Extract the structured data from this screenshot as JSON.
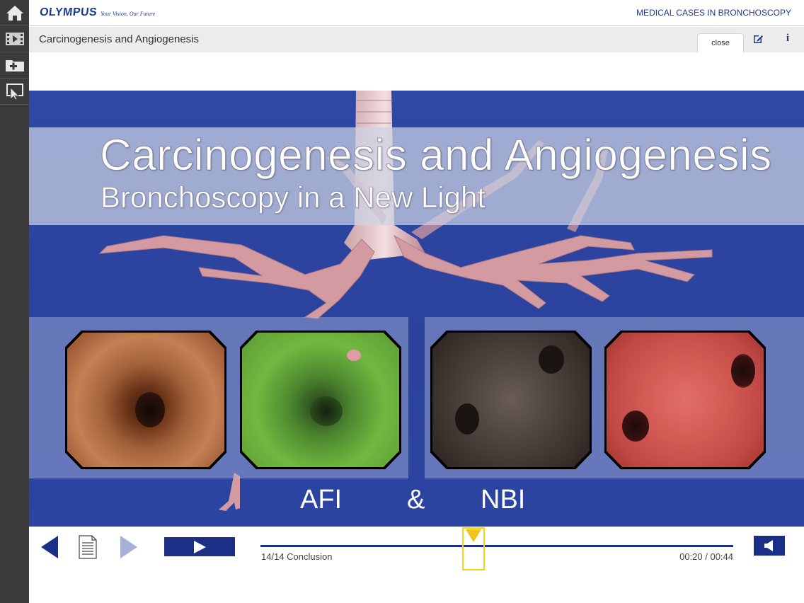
{
  "sidebar": {
    "items": [
      {
        "icon": "home-icon"
      },
      {
        "icon": "film-icon"
      },
      {
        "icon": "add-folder-icon"
      },
      {
        "icon": "presentation-icon"
      }
    ]
  },
  "header": {
    "logo_text": "OLYMPUS",
    "logo_tagline": "Your Vision, Our Future",
    "app_title": "MEDICAL CASES IN BRONCHOSCOPY"
  },
  "subheader": {
    "page_title": "Carcinogenesis and Angiogenesis",
    "close_label": "close",
    "edit_icon": "edit-icon",
    "info_icon": "info-icon",
    "info_glyph": "i"
  },
  "video": {
    "title": "Carcinogenesis and Angiogenesis",
    "subtitle": "Bronchoscopy in a New Light",
    "label_left": "AFI",
    "label_amp": "&",
    "label_right": "NBI",
    "background_color": "#2f48a6"
  },
  "player": {
    "chapter": "14/14 Conclusion",
    "time": "00:20 / 00:44",
    "progress_fraction": 0.45,
    "accent_color": "#1c2f86",
    "scrubber_color": "#f0c419",
    "icons": [
      "prev-icon",
      "chapters-icon",
      "next-icon",
      "play-icon",
      "volume-icon"
    ]
  }
}
